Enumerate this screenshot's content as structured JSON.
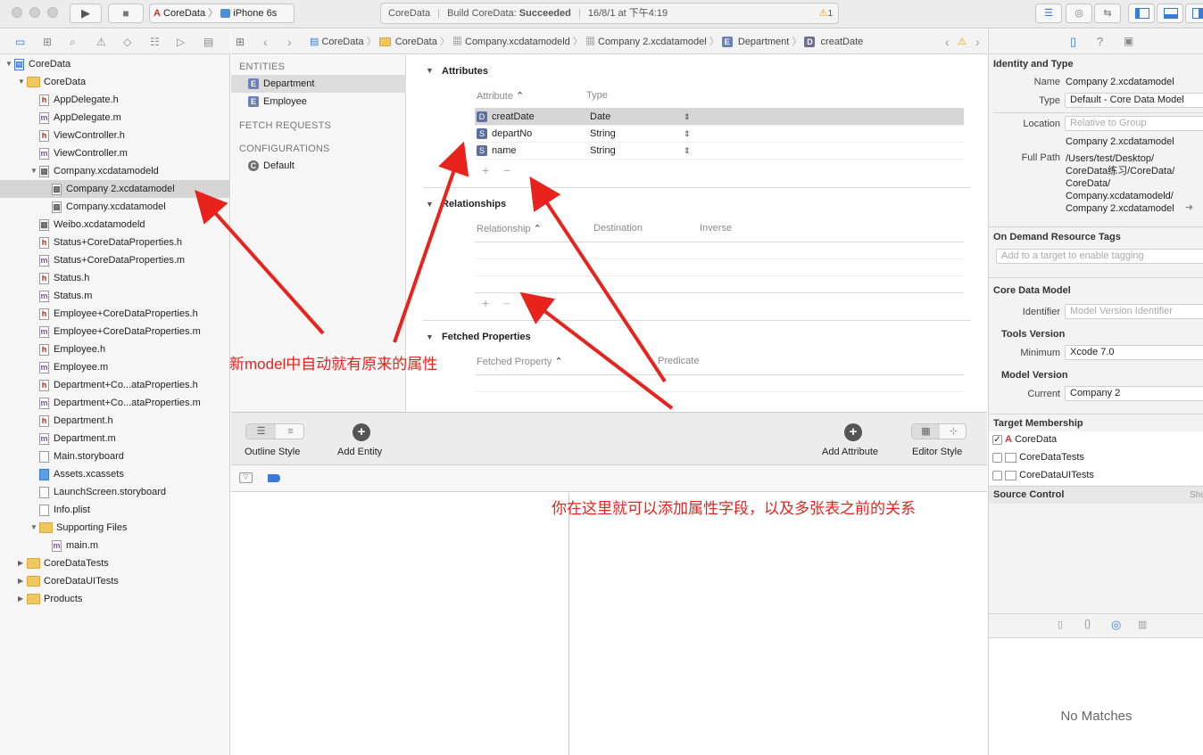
{
  "toolbar": {
    "scheme": "CoreData",
    "device": "iPhone 6s",
    "status_project": "CoreData",
    "status_text": "Build CoreData:",
    "status_result": "Succeeded",
    "status_time": "16/8/1 at 下午4:19",
    "warning_count": "1"
  },
  "sidebar": {
    "items": [
      {
        "label": "CoreData",
        "depth": 0,
        "kind": "project",
        "open": true
      },
      {
        "label": "CoreData",
        "depth": 1,
        "kind": "folder",
        "open": true
      },
      {
        "label": "AppDelegate.h",
        "depth": 2,
        "kind": "h"
      },
      {
        "label": "AppDelegate.m",
        "depth": 2,
        "kind": "m"
      },
      {
        "label": "ViewController.h",
        "depth": 2,
        "kind": "h"
      },
      {
        "label": "ViewController.m",
        "depth": 2,
        "kind": "m"
      },
      {
        "label": "Company.xcdatamodeld",
        "depth": 2,
        "kind": "model",
        "open": true
      },
      {
        "label": "Company 2.xcdatamodel",
        "depth": 3,
        "kind": "model",
        "selected": true
      },
      {
        "label": "Company.xcdatamodel",
        "depth": 3,
        "kind": "model"
      },
      {
        "label": "Weibo.xcdatamodeld",
        "depth": 2,
        "kind": "model"
      },
      {
        "label": "Status+CoreDataProperties.h",
        "depth": 2,
        "kind": "h"
      },
      {
        "label": "Status+CoreDataProperties.m",
        "depth": 2,
        "kind": "m"
      },
      {
        "label": "Status.h",
        "depth": 2,
        "kind": "h"
      },
      {
        "label": "Status.m",
        "depth": 2,
        "kind": "m"
      },
      {
        "label": "Employee+CoreDataProperties.h",
        "depth": 2,
        "kind": "h"
      },
      {
        "label": "Employee+CoreDataProperties.m",
        "depth": 2,
        "kind": "m"
      },
      {
        "label": "Employee.h",
        "depth": 2,
        "kind": "h"
      },
      {
        "label": "Employee.m",
        "depth": 2,
        "kind": "m"
      },
      {
        "label": "Department+Co...ataProperties.h",
        "depth": 2,
        "kind": "h"
      },
      {
        "label": "Department+Co...ataProperties.m",
        "depth": 2,
        "kind": "m"
      },
      {
        "label": "Department.h",
        "depth": 2,
        "kind": "h"
      },
      {
        "label": "Department.m",
        "depth": 2,
        "kind": "m"
      },
      {
        "label": "Main.storyboard",
        "depth": 2,
        "kind": "file"
      },
      {
        "label": "Assets.xcassets",
        "depth": 2,
        "kind": "assets"
      },
      {
        "label": "LaunchScreen.storyboard",
        "depth": 2,
        "kind": "file"
      },
      {
        "label": "Info.plist",
        "depth": 2,
        "kind": "file"
      },
      {
        "label": "Supporting Files",
        "depth": 2,
        "kind": "folder",
        "open": true
      },
      {
        "label": "main.m",
        "depth": 3,
        "kind": "m"
      },
      {
        "label": "CoreDataTests",
        "depth": 1,
        "kind": "folder",
        "open": false
      },
      {
        "label": "CoreDataUITests",
        "depth": 1,
        "kind": "folder",
        "open": false
      },
      {
        "label": "Products",
        "depth": 1,
        "kind": "folder",
        "open": false
      }
    ]
  },
  "jumpbar": {
    "crumbs": [
      "CoreData",
      "CoreData",
      "Company.xcdatamodeld",
      "Company 2.xcdatamodel",
      "Department",
      "creatDate"
    ]
  },
  "entities_panel": {
    "entities_header": "ENTITIES",
    "entities": [
      "Department",
      "Employee"
    ],
    "fetch_header": "FETCH REQUESTS",
    "config_header": "CONFIGURATIONS",
    "configurations": [
      "Default"
    ]
  },
  "editor": {
    "attributes_title": "Attributes",
    "attr_col": "Attribute",
    "type_col": "Type",
    "attributes": [
      {
        "badge": "D",
        "name": "creatDate",
        "type": "Date"
      },
      {
        "badge": "S",
        "name": "departNo",
        "type": "String"
      },
      {
        "badge": "S",
        "name": "name",
        "type": "String"
      }
    ],
    "relationships_title": "Relationships",
    "rel_col": "Relationship",
    "dest_col": "Destination",
    "inverse_col": "Inverse",
    "fetched_title": "Fetched Properties",
    "fetched_col": "Fetched Property",
    "predicate_col": "Predicate"
  },
  "bottombar": {
    "outline_style": "Outline Style",
    "add_entity": "Add Entity",
    "add_attribute": "Add Attribute",
    "editor_style": "Editor Style"
  },
  "inspector": {
    "identity_title": "Identity and Type",
    "name_label": "Name",
    "name_value": "Company 2.xcdatamodel",
    "type_label": "Type",
    "type_value": "Default - Core Data Model",
    "location_label": "Location",
    "location_value": "Relative to Group",
    "location_file": "Company 2.xcdatamodel",
    "fullpath_label": "Full Path",
    "fullpath_lines": [
      "/Users/test/Desktop/",
      "CoreData练习/CoreData/",
      "CoreData/",
      "Company.xcdatamodeld/",
      "Company 2.xcdatamodel"
    ],
    "odr_title": "On Demand Resource Tags",
    "odr_placeholder": "Add to a target to enable tagging",
    "cdm_title": "Core Data Model",
    "identifier_label": "Identifier",
    "identifier_placeholder": "Model Version Identifier",
    "tools_title": "Tools Version",
    "minimum_label": "Minimum",
    "minimum_value": "Xcode 7.0",
    "model_version_title": "Model Version",
    "current_label": "Current",
    "current_value": "Company 2",
    "target_title": "Target Membership",
    "targets": [
      {
        "name": "CoreData",
        "checked": true
      },
      {
        "name": "CoreDataTests",
        "checked": false
      },
      {
        "name": "CoreDataUITests",
        "checked": false
      }
    ],
    "source_control_title": "Source Control",
    "source_control_show": "Sho",
    "no_matches": "No Matches"
  },
  "annotations": {
    "left_note": "新model中自动就有原来的属性",
    "bottom_note": "你在这里就可以添加属性字段，以及多张表之前的关系"
  },
  "colors": {
    "annotation": "#e8231e",
    "selection": "#d5d5d5",
    "entity_badge": "#6b7fb8"
  }
}
